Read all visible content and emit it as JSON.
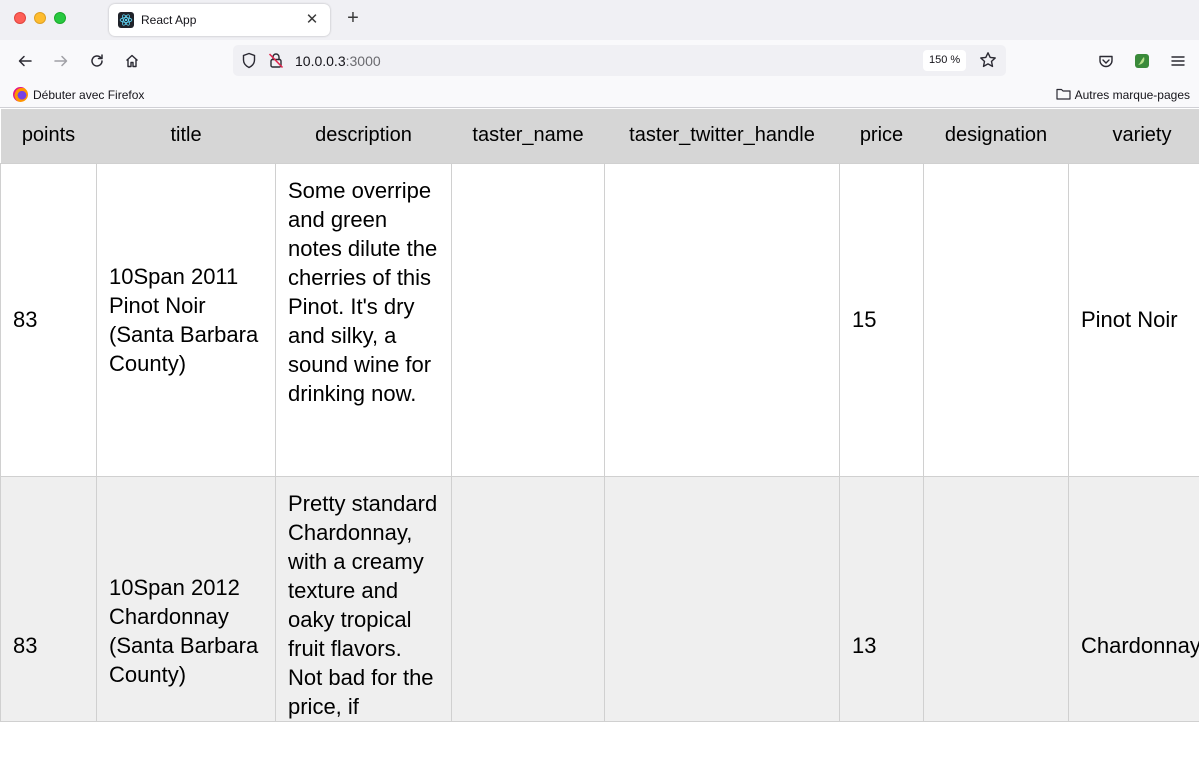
{
  "browser": {
    "tab_title": "React App",
    "tab_close": "✕",
    "new_tab": "+",
    "url_host": "10.0.0.3",
    "url_port": ":3000",
    "zoom": "150 %",
    "bookmark_left": "Débuter avec Firefox",
    "bookmark_right": "Autres marque-pages",
    "icons": [
      "react-icon",
      "back-icon",
      "forward-icon",
      "reload-icon",
      "home-icon",
      "shield-icon",
      "lock-icon",
      "star-icon",
      "pocket-icon",
      "extension-icon",
      "menu-icon",
      "firefox-icon",
      "folder-icon"
    ]
  },
  "table": {
    "headers": [
      "points",
      "title",
      "description",
      "taster_name",
      "taster_twitter_handle",
      "price",
      "designation",
      "variety"
    ],
    "rows": [
      {
        "points": "83",
        "title": "10Span 2011 Pinot Noir (Santa Barbara County)",
        "description": "Some overripe and green notes dilute the cherries of this Pinot. It's dry and silky, a sound wine for drinking now.",
        "taster_name": "",
        "taster_twitter_handle": "",
        "price": "15",
        "designation": "",
        "variety": "Pinot Noir"
      },
      {
        "points": "83",
        "title": "10Span 2012 Chardonnay (Santa Barbara County)",
        "description": "Pretty standard Chardonnay, with a creamy texture and oaky tropical fruit flavors. Not bad for the price, if",
        "taster_name": "",
        "taster_twitter_handle": "",
        "price": "13",
        "designation": "",
        "variety": "Chardonnay"
      }
    ]
  }
}
